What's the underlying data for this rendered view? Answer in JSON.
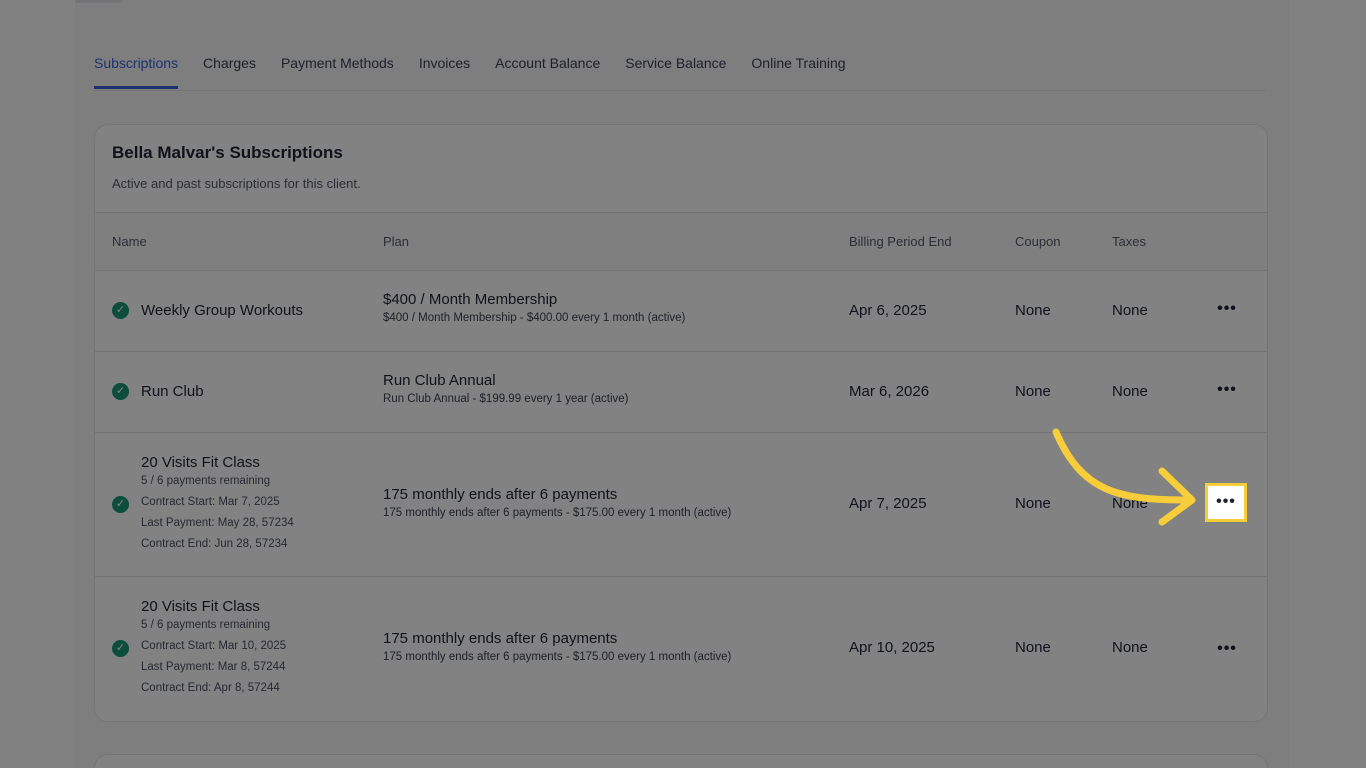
{
  "tabs": [
    "Subscriptions",
    "Charges",
    "Payment Methods",
    "Invoices",
    "Account Balance",
    "Service Balance",
    "Online Training"
  ],
  "active_tab": "Subscriptions",
  "card": {
    "title": "Bella Malvar's Subscriptions",
    "subtitle": "Active and past subscriptions for this client."
  },
  "columns": {
    "name": "Name",
    "plan": "Plan",
    "billing": "Billing Period End",
    "coupon": "Coupon",
    "taxes": "Taxes"
  },
  "rows": [
    {
      "name": "Weekly Group Workouts",
      "meta": [],
      "plan_title": "$400 / Month Membership",
      "plan_sub": "$400 / Month Membership - $400.00 every 1 month (active)",
      "billing_end": "Apr 6, 2025",
      "coupon": "None",
      "taxes": "None"
    },
    {
      "name": "Run Club",
      "meta": [],
      "plan_title": "Run Club Annual",
      "plan_sub": "Run Club Annual - $199.99 every 1 year (active)",
      "billing_end": "Mar 6, 2026",
      "coupon": "None",
      "taxes": "None"
    },
    {
      "name": "20 Visits Fit Class",
      "meta": [
        "5 / 6 payments remaining",
        "Contract Start: Mar 7, 2025",
        "Last Payment: May 28, 57234",
        "Contract End: Jun 28, 57234"
      ],
      "plan_title": "175 monthly ends after 6 payments",
      "plan_sub": "175 monthly ends after 6 payments - $175.00 every 1 month (active)",
      "billing_end": "Apr 7, 2025",
      "coupon": "None",
      "taxes": "None"
    },
    {
      "name": "20 Visits Fit Class",
      "meta": [
        "5 / 6 payments remaining",
        "Contract Start: Mar 10, 2025",
        "Last Payment: Mar 8, 57244",
        "Contract End: Apr 8, 57244"
      ],
      "plan_title": "175 monthly ends after 6 payments",
      "plan_sub": "175 monthly ends after 6 payments - $175.00 every 1 month (active)",
      "billing_end": "Apr 10, 2025",
      "coupon": "None",
      "taxes": "None"
    }
  ],
  "icons": {
    "status": "check-circle-icon",
    "actions": "more-horizontal-icon",
    "annotation": "curved-arrow-icon"
  },
  "colors": {
    "accent": "#3b63d6",
    "success": "#1a9a73",
    "highlight": "#f7cd3a",
    "overlay": "rgba(0,0,0,0.49)"
  },
  "ellipsis": "•••"
}
